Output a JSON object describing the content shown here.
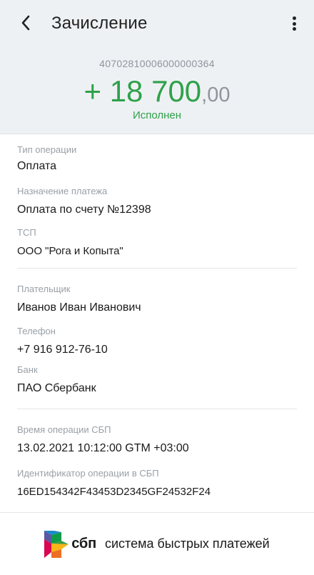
{
  "header": {
    "title": "Зачисление"
  },
  "summary": {
    "account": "40702810006000000364",
    "amount_main": "+ 18 700",
    "amount_frac": ",00",
    "status": "Исполнен",
    "accent_color": "#2fa14a"
  },
  "operation": {
    "type_label": "Тип операции",
    "type_value": "Оплата",
    "purpose_label": "Назначение платежа",
    "purpose_value": "Оплата по счету №12398",
    "tsp_label": "ТСП",
    "tsp_value": "ООО \"Рога и Копыта\""
  },
  "payer": {
    "name_label": "Плательщик",
    "name_value": "Иванов Иван Иванович",
    "phone_label": "Телефон",
    "phone_value": "+7 916 912-76-10",
    "bank_label": "Банк",
    "bank_value": "ПАО Сбербанк"
  },
  "sbp": {
    "time_label": "Время операции СБП",
    "time_value": "13.02.2021 10:12:00 GTM +03:00",
    "id_label": "Идентификатор операции в СБП",
    "id_value": "16ED154342F43453D2345GF24532F24"
  },
  "footer": {
    "logo_word": "сбп",
    "tagline": "система быстрых платежей"
  },
  "icons": {
    "back": "chevron-left-icon",
    "menu": "more-vertical-icon",
    "logo": "sbp-logo-icon"
  }
}
